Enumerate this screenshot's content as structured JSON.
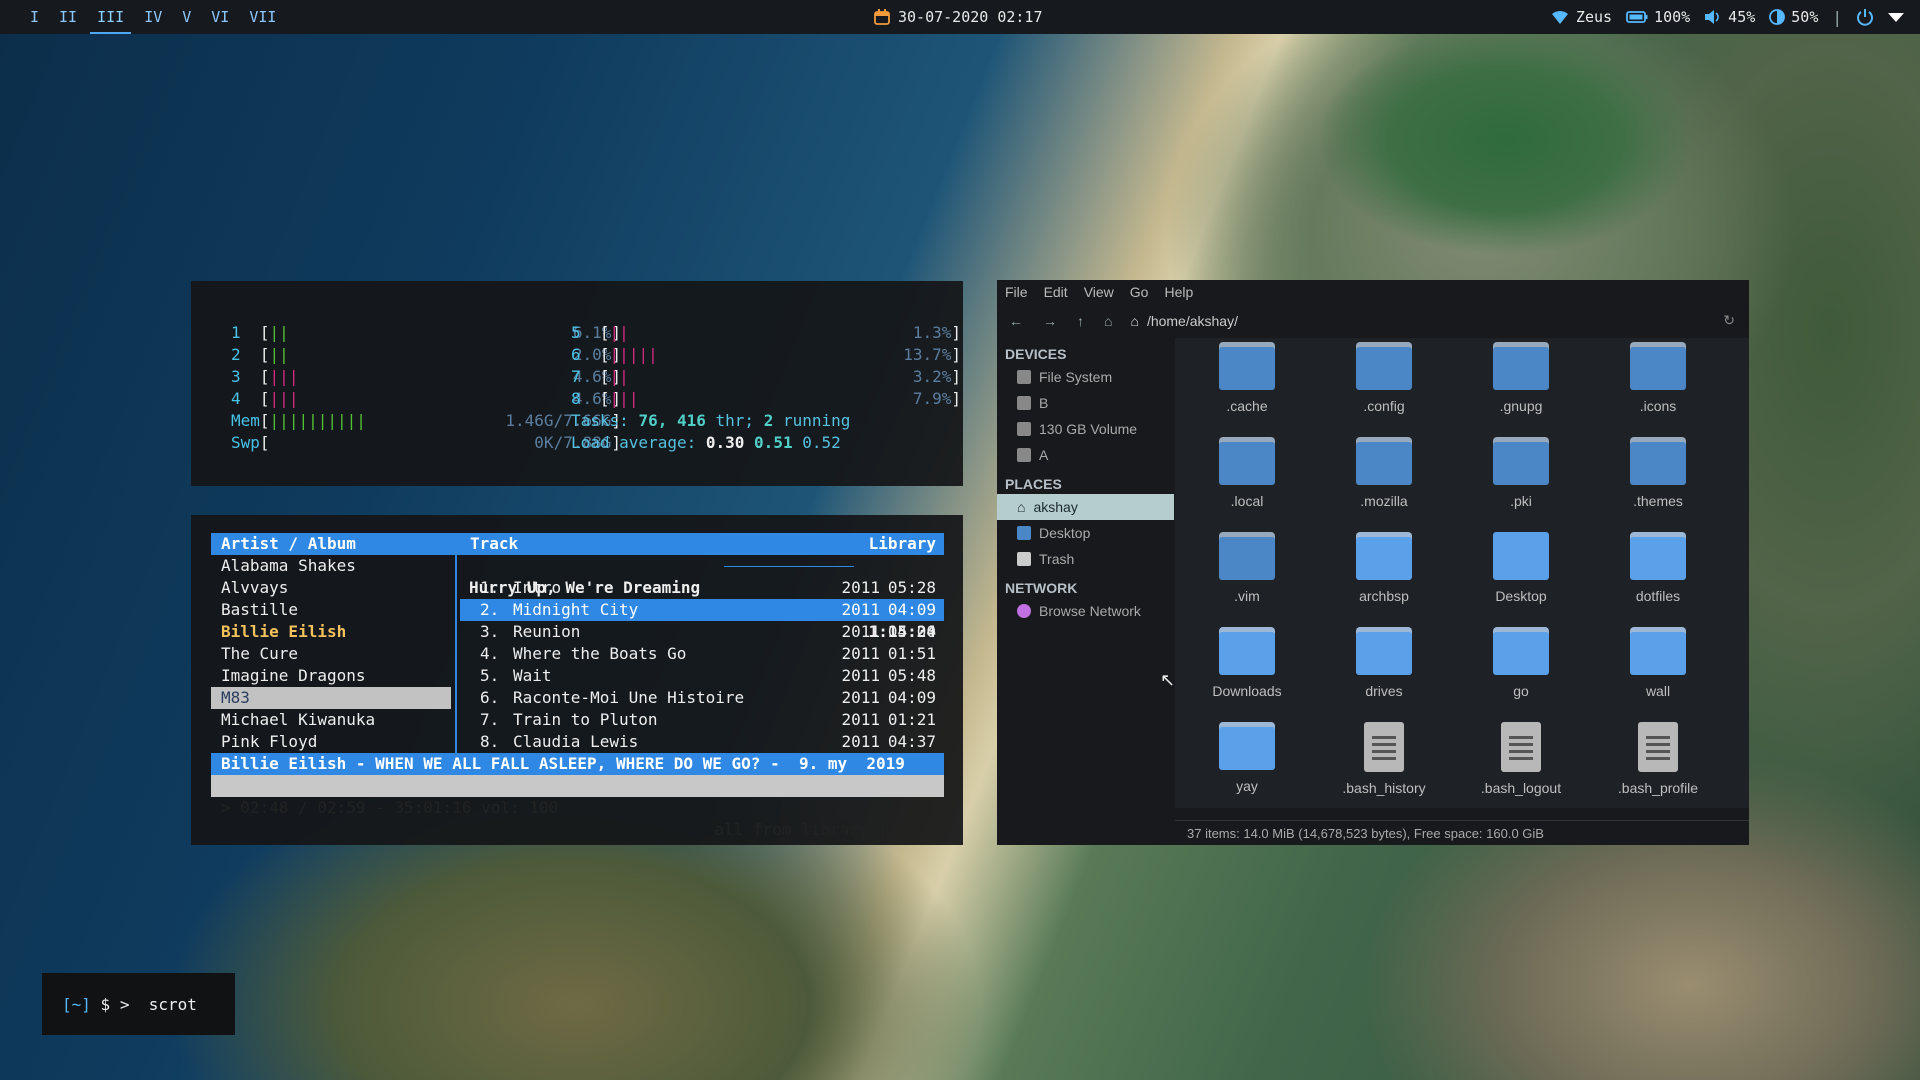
{
  "topbar": {
    "workspaces": [
      "I",
      "II",
      "III",
      "IV",
      "V",
      "VI",
      "VII"
    ],
    "active_workspace": "III",
    "datetime": "30-07-2020 02:17",
    "wifi": "Zeus",
    "battery": "100%",
    "volume": "45%",
    "brightness": "50%",
    "separator": "|"
  },
  "htop": {
    "cpus_left": [
      {
        "id": "1",
        "bars": "||",
        "pct": "6.1%"
      },
      {
        "id": "2",
        "bars": "||",
        "pct": "2.0%"
      },
      {
        "id": "3",
        "bars": "|||",
        "pct": "4.6%"
      },
      {
        "id": "4",
        "bars": "|||",
        "pct": "4.6%"
      }
    ],
    "cpus_right": [
      {
        "id": "5",
        "bars": "||",
        "pct": "1.3%"
      },
      {
        "id": "6",
        "bars": "|||||",
        "pct": "13.7%"
      },
      {
        "id": "7",
        "bars": "||",
        "pct": "3.2%"
      },
      {
        "id": "8",
        "bars": "|||",
        "pct": "7.9%"
      }
    ],
    "mem_label": "Mem",
    "mem_bars": "||||||||||",
    "mem_value": "1.46G/7.66G",
    "swp_label": "Swp",
    "swp_value": "0K/7.88G",
    "tasks_label": "Tasks:",
    "tasks": "76,",
    "threads": "416",
    "thr_label": "thr;",
    "running": "2",
    "running_label": "running",
    "load_label": "Load average:",
    "load1": "0.30",
    "load5": "0.51",
    "load15": "0.52"
  },
  "cmus": {
    "header_artist": "Artist / Album",
    "header_track": "Track",
    "header_library": "Library",
    "artists": [
      "Alabama Shakes",
      "Alvvays",
      "Bastille",
      "Billie Eilish",
      "The Cure",
      "Imagine Dragons",
      "M83",
      "Michael Kiwanuka",
      "Pink Floyd"
    ],
    "playing_artist": "Billie Eilish",
    "selected_artist": "M83",
    "album_title": "Hurry Up, We're Dreaming",
    "album_length": "1:15:24",
    "tracks": [
      {
        "n": "1.",
        "title": "Intro",
        "year": "2011",
        "dur": "05:28"
      },
      {
        "n": "2.",
        "title": "Midnight City",
        "year": "2011",
        "dur": "04:09"
      },
      {
        "n": "3.",
        "title": "Reunion",
        "year": "2011",
        "dur": "04:00"
      },
      {
        "n": "4.",
        "title": "Where the Boats Go",
        "year": "2011",
        "dur": "01:51"
      },
      {
        "n": "5.",
        "title": "Wait",
        "year": "2011",
        "dur": "05:48"
      },
      {
        "n": "6.",
        "title": "Raconte-Moi Une Histoire",
        "year": "2011",
        "dur": "04:09"
      },
      {
        "n": "7.",
        "title": "Train to Pluton",
        "year": "2011",
        "dur": "01:21"
      },
      {
        "n": "8.",
        "title": "Claudia Lewis",
        "year": "2011",
        "dur": "04:37"
      }
    ],
    "now_playing": "Billie Eilish - WHEN WE ALL FALL ASLEEP, WHERE DO WE GO? -  9. my  2019",
    "status_left": "> 02:48 / 02:59 - 35:01:16 vol: 100",
    "status_right": "all from library | C  S"
  },
  "filemanager": {
    "menu": [
      "File",
      "Edit",
      "View",
      "Go",
      "Help"
    ],
    "path": "/home/akshay/",
    "sections": {
      "devices": "DEVICES",
      "places": "PLACES",
      "network": "NETWORK"
    },
    "devices": [
      "File System",
      "B",
      "130 GB Volume",
      "A"
    ],
    "places": [
      "akshay",
      "Desktop",
      "Trash"
    ],
    "network": [
      "Browse Network"
    ],
    "items": [
      ".cache",
      ".config",
      ".gnupg",
      ".icons",
      ".local",
      ".mozilla",
      ".pki",
      ".themes",
      ".vim",
      "archbsp",
      "Desktop",
      "dotfiles",
      "Downloads",
      "drives",
      "go",
      "wall",
      "yay",
      ".bash_history",
      ".bash_logout",
      ".bash_profile"
    ],
    "status": "37 items: 14.0 MiB (14,678,523 bytes), Free space: 160.0 GiB"
  },
  "terminal": {
    "prompt_dir": "[~]",
    "prompt_sym": "$ >",
    "command": "scrot"
  },
  "colors": {
    "accent": "#2f88e4",
    "bar_bg": "#161a1e",
    "highlight_artist": "#f3c25c"
  }
}
